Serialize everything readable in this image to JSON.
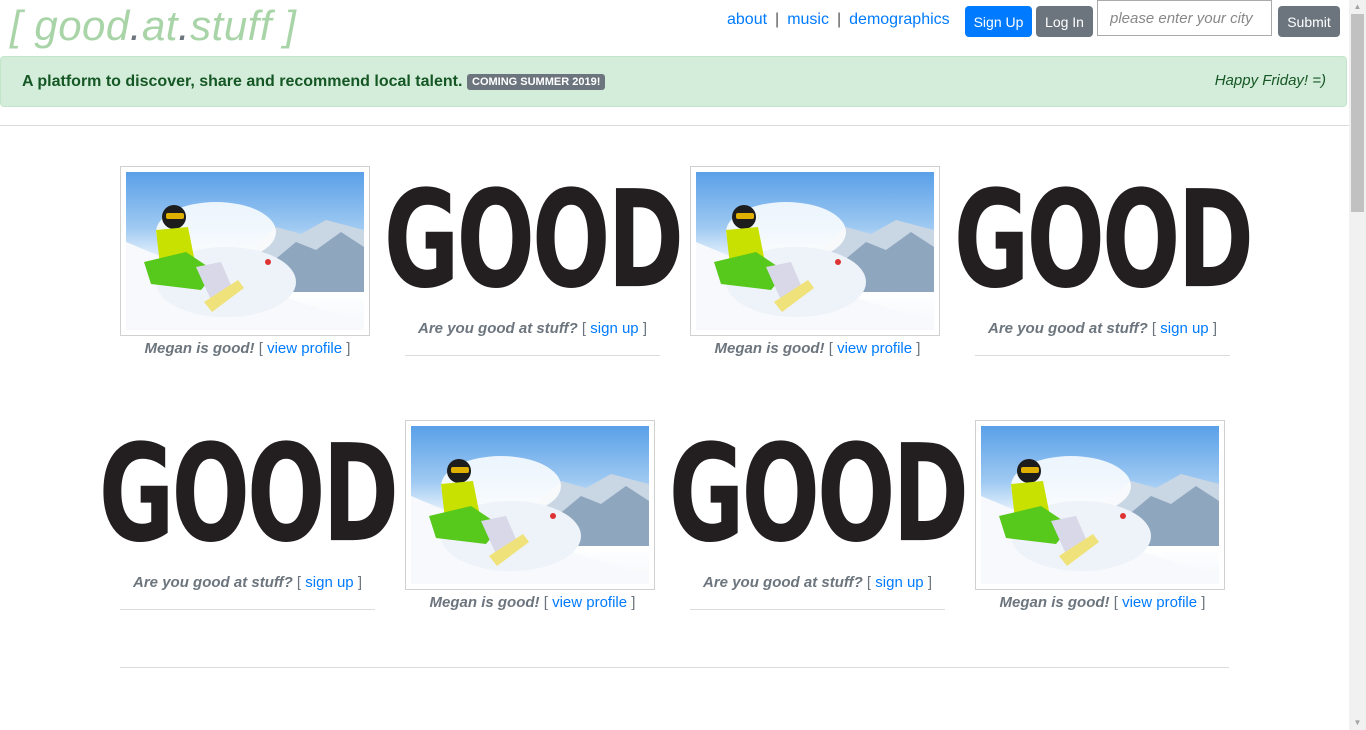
{
  "header": {
    "logo": {
      "open": "[ ",
      "w1": "good",
      "dot1": ".",
      "w2": "at",
      "dot2": ".",
      "w3": "stuff",
      "close": " ]"
    },
    "nav": [
      {
        "label": "about"
      },
      {
        "label": "music"
      },
      {
        "label": "demographics"
      }
    ],
    "nav_separator": "|",
    "signup_label": "Sign Up",
    "login_label": "Log In",
    "city_placeholder": "please enter your city",
    "submit_label": "Submit"
  },
  "alert": {
    "text": "A platform to discover, share and recommend local talent.",
    "badge": "COMING SUMMER 2019!",
    "greeting": "Happy Friday! =)"
  },
  "card_text": {
    "profile_caption": "Megan is good!",
    "profile_link": "view profile",
    "signup_caption": "Are you good at stuff?",
    "signup_link": "sign up",
    "good_text": "GOOD",
    "bracket_open": "[",
    "bracket_close": "]"
  },
  "cards": [
    {
      "type": "profile"
    },
    {
      "type": "good"
    },
    {
      "type": "profile"
    },
    {
      "type": "good"
    },
    {
      "type": "good"
    },
    {
      "type": "profile"
    },
    {
      "type": "good"
    },
    {
      "type": "profile"
    }
  ]
}
